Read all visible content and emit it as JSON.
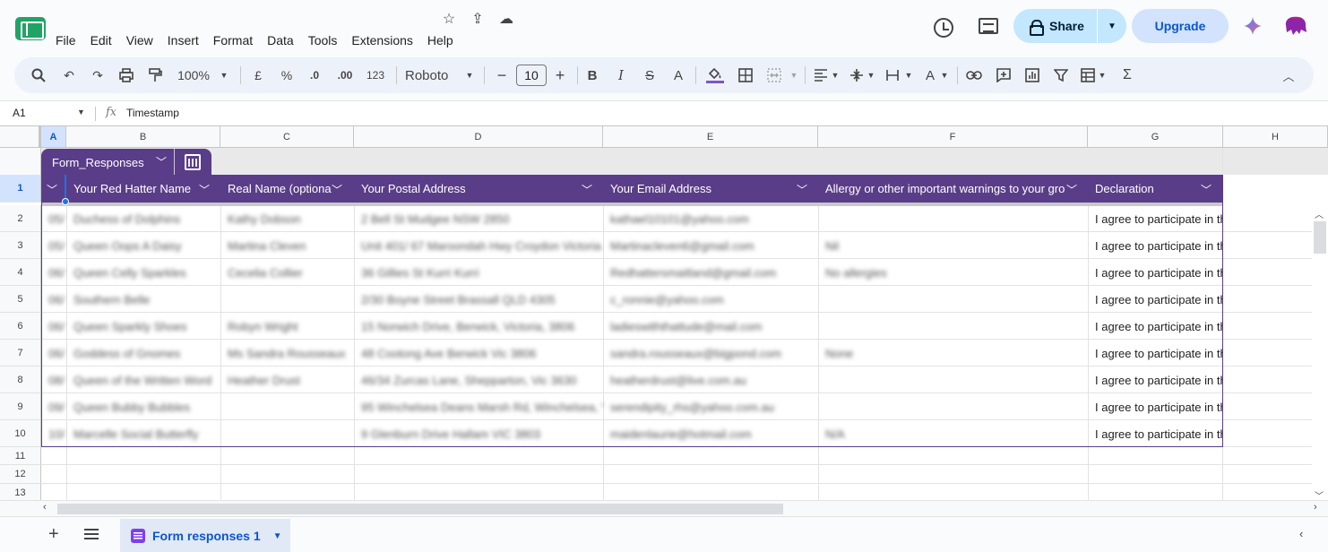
{
  "menubar": [
    "File",
    "Edit",
    "View",
    "Insert",
    "Format",
    "Data",
    "Tools",
    "Extensions",
    "Help"
  ],
  "header": {
    "share_label": "Share",
    "upgrade_label": "Upgrade"
  },
  "toolbar": {
    "zoom": "100%",
    "currency": "£",
    "percent": "%",
    "dec_decrease": ".0",
    "dec_increase": ".00",
    "number_format": "123",
    "font": "Roboto",
    "font_size": "10",
    "bold": "B",
    "italic": "I",
    "strike": "S",
    "text_color": "A",
    "text_color2": "A",
    "sigma": "Σ"
  },
  "formula_bar": {
    "cell_ref": "A1",
    "fx": "fx",
    "content": "Timestamp"
  },
  "columns": [
    "A",
    "B",
    "C",
    "D",
    "E",
    "F",
    "G",
    "H"
  ],
  "rows": [
    "1",
    "2",
    "3",
    "4",
    "5",
    "6",
    "7",
    "8",
    "9",
    "10",
    "11",
    "12",
    "13"
  ],
  "table": {
    "name": "Form_Responses",
    "headers": [
      "",
      "Your Red Hatter Name",
      "Real Name (optional)",
      "Your Postal Address",
      "Your Email Address",
      "Allergy or other important warnings to your group",
      "Declaration"
    ],
    "rows": [
      [
        "05/",
        "Duchess of Dolphins",
        "Kathy Dobson",
        "2 Bell St Mudgee NSW 2850",
        "kathael10101@yahoo.com",
        "",
        "I agree to participate in the"
      ],
      [
        "05/",
        "Queen Oops A Daisy",
        "Martina Cleven",
        "Unit 401/ 67 Maroondah Hwy Croydon Victoria",
        "Martinacleven6@gmail.com",
        "Nil",
        "I agree to participate in the"
      ],
      [
        "06/",
        "Queen Celly Sparkles",
        "Cecelia Collier",
        "36 Gillies St Kurri Kurri",
        "Redhattersmaitland@gmail.com",
        "No allergies",
        "I agree to participate in the"
      ],
      [
        "06/",
        "Southern Belle",
        "",
        "2/30 Boyne Street Brassall QLD 4305",
        "c_ronnie@yahoo.com",
        "",
        "I agree to participate in the"
      ],
      [
        "06/",
        "Queen Sparkly Shoes",
        "Robyn Wright",
        "15 Norwich Drive, Berwick, Victoria, 3806",
        "ladieswiththattude@mail.com",
        "",
        "I agree to participate in the"
      ],
      [
        "06/",
        "Goddess of Gnomes",
        "Ms Sandra Rousseaux",
        "48 Cootong Ave Berwick Vic 3806",
        "sandra.rousseaux@bigpond.com",
        "None",
        "I agree to participate in the"
      ],
      [
        "08/",
        "Queen of the Written Word",
        "Heather Drust",
        "46/34 Zurcas Lane, Shepparton, Vic 3630",
        "heatherdrust@live.com.au",
        "",
        "I agree to participate in the"
      ],
      [
        "09/",
        "Queen Bubby Bubbles",
        "",
        "95 Winchelsea Deans Marsh Rd, Winchelsea, Vic",
        "serendipity_rhs@yahoo.com.au",
        "",
        "I agree to participate in the"
      ],
      [
        "10/",
        "Marcelle Social Butterfly",
        "",
        "9 Glenburn Drive Hallam VIC 3803",
        "maidenlaurie@hotmail.com",
        "N/A",
        "I agree to participate in the"
      ]
    ]
  },
  "sheet_tab": {
    "label": "Form responses 1"
  },
  "colors": {
    "table_header": "#5a3d88",
    "share_bg": "#c2e7ff",
    "upgrade_bg": "#d3e3fd",
    "selected": "#1a73e8"
  }
}
